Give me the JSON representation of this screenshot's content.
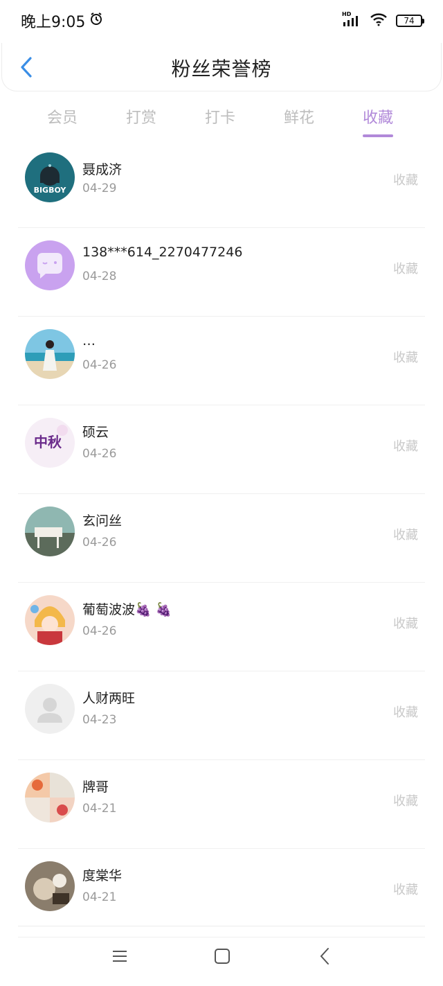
{
  "status": {
    "time": "晚上9:05",
    "signal_label": "HD",
    "battery": "74"
  },
  "header": {
    "title": "粉丝荣誉榜"
  },
  "tabs": [
    {
      "label": "会员"
    },
    {
      "label": "打赏"
    },
    {
      "label": "打卡"
    },
    {
      "label": "鲜花"
    },
    {
      "label": "收藏"
    }
  ],
  "active_tab": "收藏",
  "fans": [
    {
      "name": "聂成济",
      "date": "04-29",
      "action": "收藏"
    },
    {
      "name": "138***614_2270477246",
      "date": "04-28",
      "action": "收藏"
    },
    {
      "name": "…",
      "date": "04-26",
      "action": "收藏"
    },
    {
      "name": "硕云",
      "date": "04-26",
      "action": "收藏"
    },
    {
      "name": "玄问丝",
      "date": "04-26",
      "action": "收藏"
    },
    {
      "name": "葡萄波波🍇 🍇",
      "date": "04-26",
      "action": "收藏"
    },
    {
      "name": "人财两旺",
      "date": "04-23",
      "action": "收藏"
    },
    {
      "name": "牌哥",
      "date": "04-21",
      "action": "收藏"
    },
    {
      "name": "度棠华",
      "date": "04-21",
      "action": "收藏"
    }
  ],
  "avatar_texts": {
    "bigboy": "BIGBOY",
    "mid_autumn": "中秋"
  }
}
